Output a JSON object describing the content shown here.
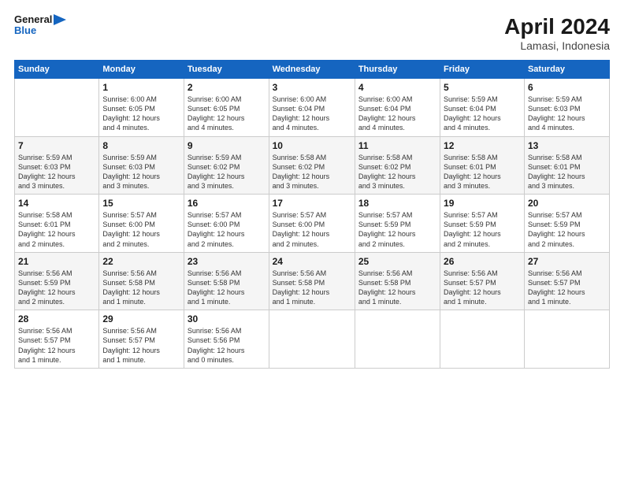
{
  "header": {
    "logo_line1": "General",
    "logo_line2": "Blue",
    "title": "April 2024",
    "subtitle": "Lamasi, Indonesia"
  },
  "days_of_week": [
    "Sunday",
    "Monday",
    "Tuesday",
    "Wednesday",
    "Thursday",
    "Friday",
    "Saturday"
  ],
  "weeks": [
    [
      {
        "num": "",
        "detail": ""
      },
      {
        "num": "1",
        "detail": "Sunrise: 6:00 AM\nSunset: 6:05 PM\nDaylight: 12 hours\nand 4 minutes."
      },
      {
        "num": "2",
        "detail": "Sunrise: 6:00 AM\nSunset: 6:05 PM\nDaylight: 12 hours\nand 4 minutes."
      },
      {
        "num": "3",
        "detail": "Sunrise: 6:00 AM\nSunset: 6:04 PM\nDaylight: 12 hours\nand 4 minutes."
      },
      {
        "num": "4",
        "detail": "Sunrise: 6:00 AM\nSunset: 6:04 PM\nDaylight: 12 hours\nand 4 minutes."
      },
      {
        "num": "5",
        "detail": "Sunrise: 5:59 AM\nSunset: 6:04 PM\nDaylight: 12 hours\nand 4 minutes."
      },
      {
        "num": "6",
        "detail": "Sunrise: 5:59 AM\nSunset: 6:03 PM\nDaylight: 12 hours\nand 4 minutes."
      }
    ],
    [
      {
        "num": "7",
        "detail": "Sunrise: 5:59 AM\nSunset: 6:03 PM\nDaylight: 12 hours\nand 3 minutes."
      },
      {
        "num": "8",
        "detail": "Sunrise: 5:59 AM\nSunset: 6:03 PM\nDaylight: 12 hours\nand 3 minutes."
      },
      {
        "num": "9",
        "detail": "Sunrise: 5:59 AM\nSunset: 6:02 PM\nDaylight: 12 hours\nand 3 minutes."
      },
      {
        "num": "10",
        "detail": "Sunrise: 5:58 AM\nSunset: 6:02 PM\nDaylight: 12 hours\nand 3 minutes."
      },
      {
        "num": "11",
        "detail": "Sunrise: 5:58 AM\nSunset: 6:02 PM\nDaylight: 12 hours\nand 3 minutes."
      },
      {
        "num": "12",
        "detail": "Sunrise: 5:58 AM\nSunset: 6:01 PM\nDaylight: 12 hours\nand 3 minutes."
      },
      {
        "num": "13",
        "detail": "Sunrise: 5:58 AM\nSunset: 6:01 PM\nDaylight: 12 hours\nand 3 minutes."
      }
    ],
    [
      {
        "num": "14",
        "detail": "Sunrise: 5:58 AM\nSunset: 6:01 PM\nDaylight: 12 hours\nand 2 minutes."
      },
      {
        "num": "15",
        "detail": "Sunrise: 5:57 AM\nSunset: 6:00 PM\nDaylight: 12 hours\nand 2 minutes."
      },
      {
        "num": "16",
        "detail": "Sunrise: 5:57 AM\nSunset: 6:00 PM\nDaylight: 12 hours\nand 2 minutes."
      },
      {
        "num": "17",
        "detail": "Sunrise: 5:57 AM\nSunset: 6:00 PM\nDaylight: 12 hours\nand 2 minutes."
      },
      {
        "num": "18",
        "detail": "Sunrise: 5:57 AM\nSunset: 5:59 PM\nDaylight: 12 hours\nand 2 minutes."
      },
      {
        "num": "19",
        "detail": "Sunrise: 5:57 AM\nSunset: 5:59 PM\nDaylight: 12 hours\nand 2 minutes."
      },
      {
        "num": "20",
        "detail": "Sunrise: 5:57 AM\nSunset: 5:59 PM\nDaylight: 12 hours\nand 2 minutes."
      }
    ],
    [
      {
        "num": "21",
        "detail": "Sunrise: 5:56 AM\nSunset: 5:59 PM\nDaylight: 12 hours\nand 2 minutes."
      },
      {
        "num": "22",
        "detail": "Sunrise: 5:56 AM\nSunset: 5:58 PM\nDaylight: 12 hours\nand 1 minute."
      },
      {
        "num": "23",
        "detail": "Sunrise: 5:56 AM\nSunset: 5:58 PM\nDaylight: 12 hours\nand 1 minute."
      },
      {
        "num": "24",
        "detail": "Sunrise: 5:56 AM\nSunset: 5:58 PM\nDaylight: 12 hours\nand 1 minute."
      },
      {
        "num": "25",
        "detail": "Sunrise: 5:56 AM\nSunset: 5:58 PM\nDaylight: 12 hours\nand 1 minute."
      },
      {
        "num": "26",
        "detail": "Sunrise: 5:56 AM\nSunset: 5:57 PM\nDaylight: 12 hours\nand 1 minute."
      },
      {
        "num": "27",
        "detail": "Sunrise: 5:56 AM\nSunset: 5:57 PM\nDaylight: 12 hours\nand 1 minute."
      }
    ],
    [
      {
        "num": "28",
        "detail": "Sunrise: 5:56 AM\nSunset: 5:57 PM\nDaylight: 12 hours\nand 1 minute."
      },
      {
        "num": "29",
        "detail": "Sunrise: 5:56 AM\nSunset: 5:57 PM\nDaylight: 12 hours\nand 1 minute."
      },
      {
        "num": "30",
        "detail": "Sunrise: 5:56 AM\nSunset: 5:56 PM\nDaylight: 12 hours\nand 0 minutes."
      },
      {
        "num": "",
        "detail": ""
      },
      {
        "num": "",
        "detail": ""
      },
      {
        "num": "",
        "detail": ""
      },
      {
        "num": "",
        "detail": ""
      }
    ]
  ]
}
